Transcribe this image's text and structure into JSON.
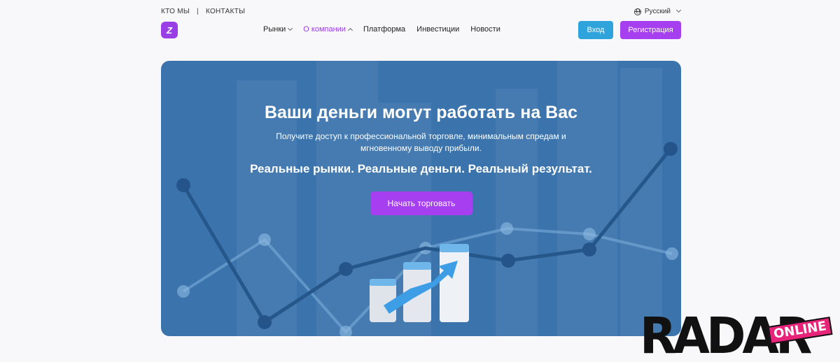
{
  "topbar": {
    "about_link": "КТО МЫ",
    "separator": "|",
    "contacts_link": "КОНТАКТЫ",
    "language": "Русский"
  },
  "logo": {
    "glyph": "Z"
  },
  "nav": {
    "items": [
      {
        "label": "Рынки",
        "has_dropdown": true,
        "active": false
      },
      {
        "label": "О компании",
        "has_dropdown": true,
        "active": true
      },
      {
        "label": "Платформа",
        "has_dropdown": false,
        "active": false
      },
      {
        "label": "Инвестиции",
        "has_dropdown": false,
        "active": false
      },
      {
        "label": "Новости",
        "has_dropdown": false,
        "active": false
      }
    ]
  },
  "auth": {
    "login_label": "Вход",
    "register_label": "Регистрация"
  },
  "hero": {
    "title": "Ваши деньги могут работать на Вас",
    "subtitle": "Получите доступ к профессиональной торговле, минимальным спредам и мгновенному выводу прибыли.",
    "tagline": "Реальные рынки. Реальные деньги. Реальный результат.",
    "cta_label": "Начать торговать"
  },
  "watermark": {
    "word": "RADAR",
    "badge": "ONLINE"
  },
  "colors": {
    "accent": "#a53ff0",
    "login": "#2ea3dc",
    "hero_bg": "#3b74ad"
  }
}
